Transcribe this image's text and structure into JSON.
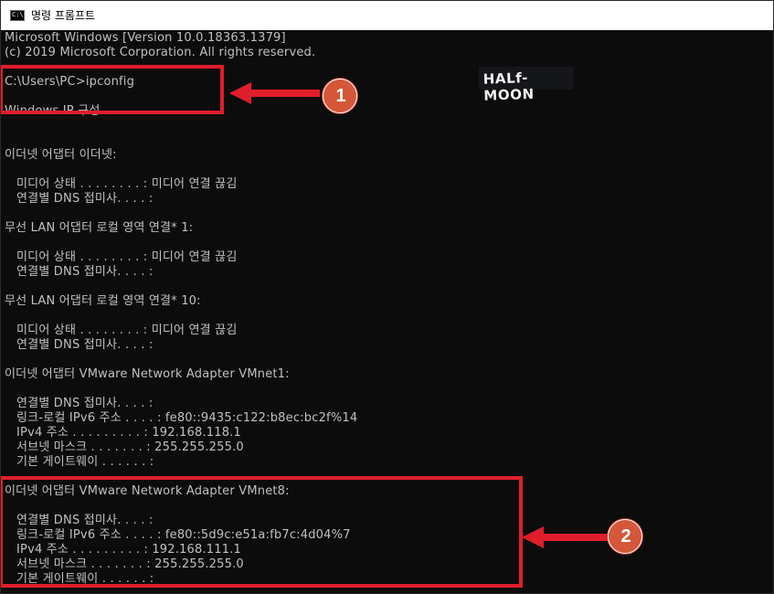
{
  "window": {
    "title": "명령 프롬프트",
    "icon_label": "C:\\."
  },
  "console": {
    "lines": [
      "Microsoft Windows [Version 10.0.18363.1379]",
      "(c) 2019 Microsoft Corporation. All rights reserved.",
      "",
      "C:\\Users\\PC>ipconfig",
      "",
      "Windows IP 구성",
      "",
      "",
      "이더넷 어댑터 이더넷:",
      "",
      "   미디어 상태 . . . . . . . . : 미디어 연결 끊김",
      "   연결별 DNS 접미사. . . . :",
      "",
      "무선 LAN 어댑터 로컬 영역 연결* 1:",
      "",
      "   미디어 상태 . . . . . . . . : 미디어 연결 끊김",
      "   연결별 DNS 접미사. . . . :",
      "",
      "무선 LAN 어댑터 로컬 영역 연결* 10:",
      "",
      "   미디어 상태 . . . . . . . . : 미디어 연결 끊김",
      "   연결별 DNS 접미사. . . . :",
      "",
      "이더넷 어댑터 VMware Network Adapter VMnet1:",
      "",
      "   연결별 DNS 접미사. . . . :",
      "   링크-로컬 IPv6 주소 . . . . : fe80::9435:c122:b8ec:bc2f%14",
      "   IPv4 주소 . . . . . . . . . : 192.168.118.1",
      "   서브넷 마스크 . . . . . . . : 255.255.255.0",
      "   기본 게이트웨이 . . . . . . :",
      "",
      "이더넷 어댑터 VMware Network Adapter VMnet8:",
      "",
      "   연결별 DNS 접미사. . . . :",
      "   링크-로컬 IPv6 주소 . . . . : fe80::5d9c:e51a:fb7c:4d04%7",
      "   IPv4 주소 . . . . . . . . . : 192.168.111.1",
      "   서브넷 마스크 . . . . . . . : 255.255.255.0",
      "   기본 게이트웨이 . . . . . . :"
    ]
  },
  "watermark": {
    "text": "HALf-MOON"
  },
  "annotations": {
    "color": "#e01e2b",
    "badge_color": "#d4573a",
    "callouts": [
      {
        "number": "1"
      },
      {
        "number": "2"
      }
    ]
  }
}
